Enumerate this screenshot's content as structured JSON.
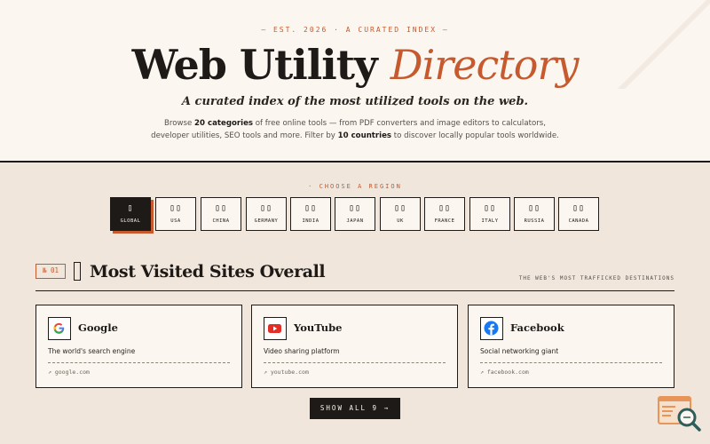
{
  "hero": {
    "eyebrow": "— EST. 2026 · A CURATED INDEX —",
    "title_main": "Web Utility",
    "title_accent": "Directory",
    "subtitle": "A curated index of the most utilized tools on the web.",
    "desc_1": "Browse ",
    "desc_categories": "20 categories",
    "desc_2": " of free online tools — from PDF converters and image editors to calculators,",
    "desc_3": "developer utilities, SEO tools and more. Filter by ",
    "desc_countries": "10 countries",
    "desc_4": " to discover locally popular tools worldwide."
  },
  "region_picker": {
    "label": "· CHOOSE A REGION",
    "regions": [
      {
        "name": "GLOBAL",
        "flag": "▯",
        "active": true
      },
      {
        "name": "USA",
        "flag": "▯▯"
      },
      {
        "name": "CHINA",
        "flag": "▯▯"
      },
      {
        "name": "GERMANY",
        "flag": "▯▯"
      },
      {
        "name": "INDIA",
        "flag": "▯▯"
      },
      {
        "name": "JAPAN",
        "flag": "▯▯"
      },
      {
        "name": "UK",
        "flag": "▯▯"
      },
      {
        "name": "FRANCE",
        "flag": "▯▯"
      },
      {
        "name": "ITALY",
        "flag": "▯▯"
      },
      {
        "name": "RUSSIA",
        "flag": "▯▯"
      },
      {
        "name": "CANADA",
        "flag": "▯▯"
      }
    ]
  },
  "section": {
    "number": "№ 01",
    "title": "Most Visited Sites Overall",
    "tagline": "THE WEB'S MOST TRAFFICKED DESTINATIONS"
  },
  "cards": [
    {
      "name": "Google",
      "desc": "The world's search engine",
      "url": "↗ google.com",
      "icon": "google-icon"
    },
    {
      "name": "YouTube",
      "desc": "Video sharing platform",
      "url": "↗ youtube.com",
      "icon": "youtube-icon"
    },
    {
      "name": "Facebook",
      "desc": "Social networking giant",
      "url": "↗ facebook.com",
      "icon": "facebook-icon"
    }
  ],
  "show_all_label": "SHOW ALL 9 →",
  "colors": {
    "accent": "#c65a2e",
    "ink": "#1d1a17",
    "paper": "#fbf6ef",
    "background": "#f0e6dc"
  }
}
